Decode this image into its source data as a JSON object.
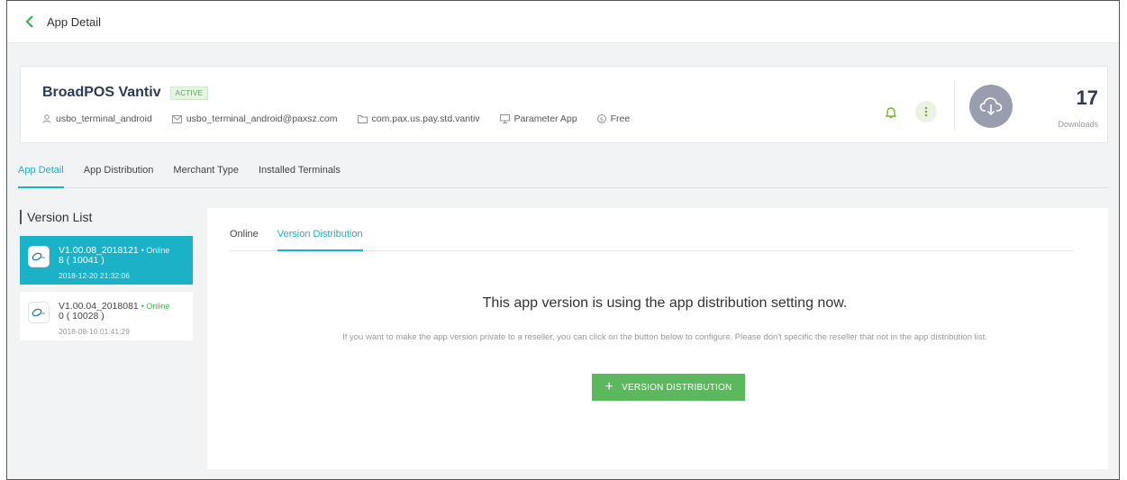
{
  "header": {
    "title": "App Detail"
  },
  "app": {
    "name": "BroadPOS Vantiv",
    "status": "ACTIVE",
    "developer": "usbo_terminal_android",
    "email": "usbo_terminal_android@paxsz.com",
    "package": "com.pax.us.pay.std.vantiv",
    "type": "Parameter App",
    "price": "Free",
    "downloads": "17",
    "downloads_label": "Downloads"
  },
  "tabs": [
    {
      "label": "App Detail",
      "active": true
    },
    {
      "label": "App Distribution",
      "active": false
    },
    {
      "label": "Merchant Type",
      "active": false
    },
    {
      "label": "Installed Terminals",
      "active": false
    }
  ],
  "version_list": {
    "title": "Version List",
    "items": [
      {
        "version": "V1.00.08_2018121",
        "status": "• Online",
        "code": "8 ( 10041 )",
        "date": "2018-12-20 21:32:06",
        "selected": true
      },
      {
        "version": "V1.00.04_2018081",
        "status": "• Online",
        "code": "0 ( 10028 )",
        "date": "2018-08-10 01:41:29",
        "selected": false
      }
    ]
  },
  "panel": {
    "tabs": [
      {
        "label": "Online",
        "active": false
      },
      {
        "label": "Version Distribution",
        "active": true
      }
    ],
    "title": "This app version is using the app distribution setting now.",
    "description": "If you want to make the app version private to a reseller, you can click on the button below to configure. Please don't specific the reseller that not in the app distribution list.",
    "button_label": "VERSION DISTRIBUTION"
  },
  "colors": {
    "accent": "#1bb1c6",
    "button_green": "#5cb85c",
    "online_green": "#3cb44b",
    "bell_green": "#7ab32e"
  }
}
